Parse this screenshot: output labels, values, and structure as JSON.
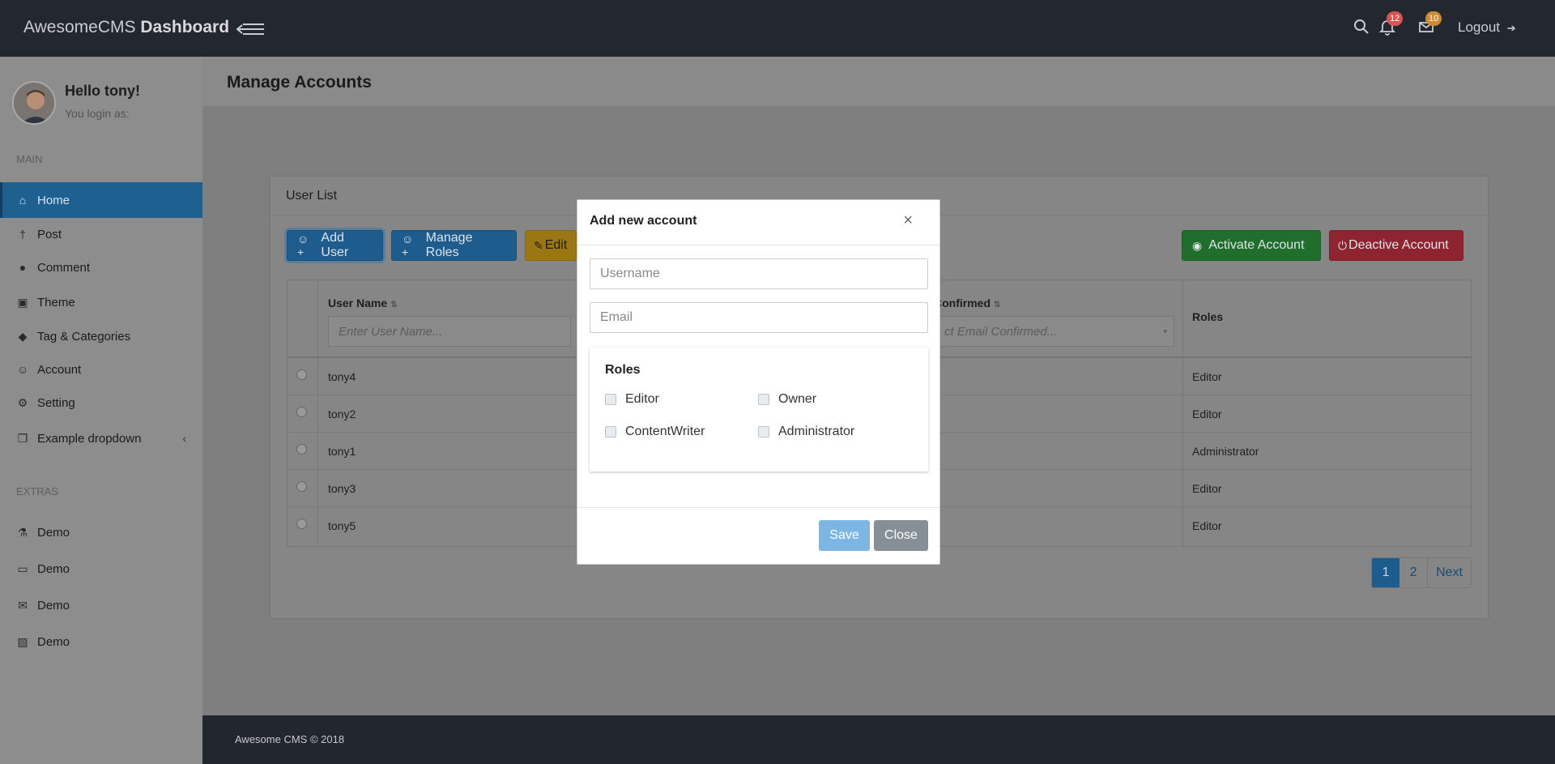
{
  "topbar": {
    "brand_light": "AwesomeCMS",
    "brand_bold": "Dashboard",
    "notifications_count": "12",
    "messages_count": "10",
    "logout_label": "Logout"
  },
  "sidebar": {
    "greeting": "Hello tony!",
    "login_as": "You login as:",
    "main_section": "MAIN",
    "items": [
      {
        "label": "Home",
        "icon": "home-icon"
      },
      {
        "label": "Post",
        "icon": "pin-icon"
      },
      {
        "label": "Comment",
        "icon": "comment-icon"
      },
      {
        "label": "Theme",
        "icon": "theme-icon"
      },
      {
        "label": "Tag & Categories",
        "icon": "tags-icon"
      },
      {
        "label": "Account",
        "icon": "user-plus-icon"
      },
      {
        "label": "Setting",
        "icon": "gears-icon"
      },
      {
        "label": "Example dropdown",
        "icon": "copy-icon"
      }
    ],
    "extras_section": "EXTRAS",
    "extras": [
      {
        "label": "Demo",
        "icon": "flask-icon"
      },
      {
        "label": "Demo",
        "icon": "monitor-icon"
      },
      {
        "label": "Demo",
        "icon": "envelope-icon"
      },
      {
        "label": "Demo",
        "icon": "image-icon"
      }
    ]
  },
  "main": {
    "page_title": "Manage Accounts",
    "panel_title": "User List",
    "toolbar": {
      "add_user": "Add User",
      "manage_roles": "Manage Roles",
      "edit": "Edit",
      "activate": "Activate Account",
      "deactivate": "Deactive Account"
    },
    "table": {
      "col_username": "User Name",
      "col_confirmed": "Confirmed",
      "col_roles": "Roles",
      "username_filter_placeholder": "Enter User Name...",
      "confirmed_filter_placeholder": "ct Email Confirmed...",
      "rows": [
        {
          "username": "tony4",
          "role": "Editor"
        },
        {
          "username": "tony2",
          "role": "Editor"
        },
        {
          "username": "tony1",
          "role": "Administrator"
        },
        {
          "username": "tony3",
          "role": "Editor"
        },
        {
          "username": "tony5",
          "role": "Editor"
        }
      ]
    },
    "pagination": [
      "1",
      "2",
      "Next"
    ]
  },
  "footer": {
    "text": "Awesome CMS © 2018"
  },
  "modal": {
    "title": "Add new account",
    "close_glyph": "×",
    "username_placeholder": "Username",
    "email_placeholder": "Email",
    "roles_title": "Roles",
    "roles": [
      "Editor",
      "Owner",
      "ContentWriter",
      "Administrator"
    ],
    "save_label": "Save",
    "close_label": "Close"
  }
}
